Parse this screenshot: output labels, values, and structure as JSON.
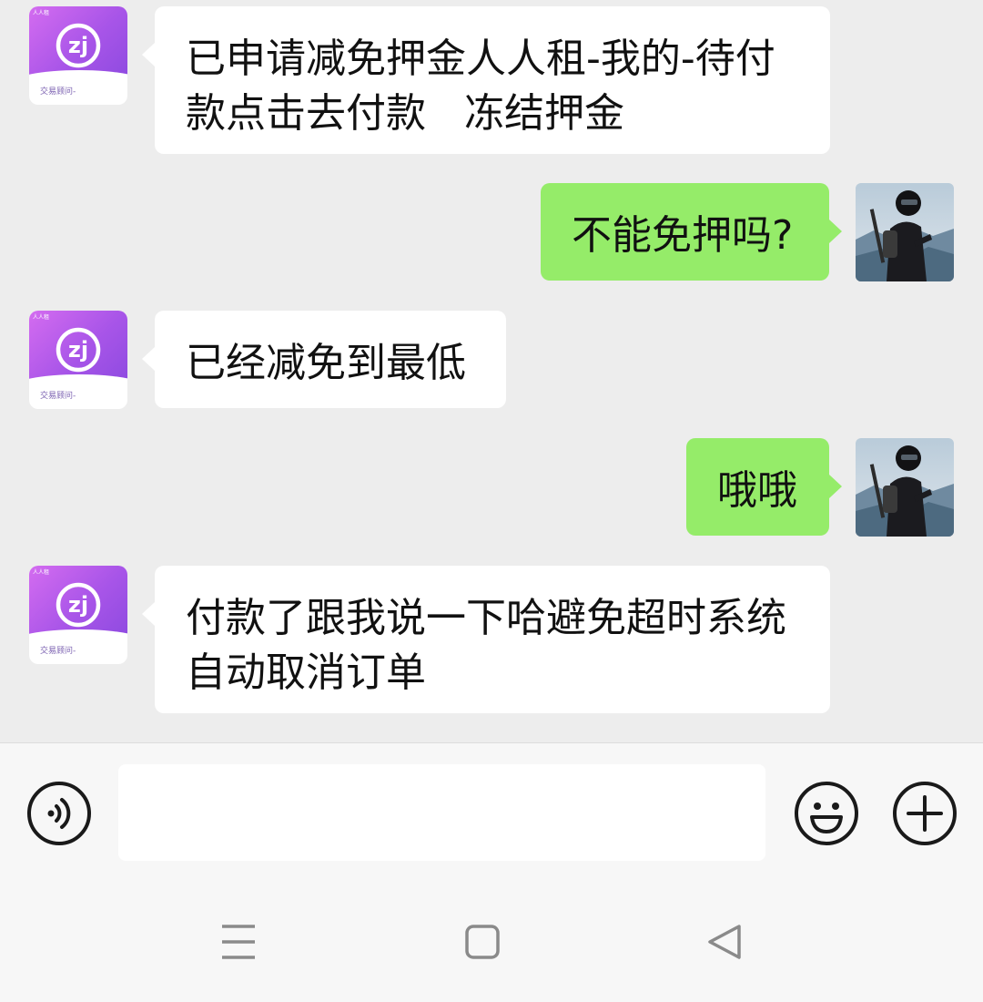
{
  "messages": [
    {
      "side": "in",
      "text_lines": [
        "已申请减免押金人人租-我的-待付",
        "款点击去付款   冻结押金"
      ]
    },
    {
      "side": "out",
      "text_lines": [
        "不能免押吗?"
      ]
    },
    {
      "side": "in",
      "text_lines": [
        "已经减免到最低"
      ]
    },
    {
      "side": "out",
      "text_lines": [
        "哦哦"
      ]
    },
    {
      "side": "in",
      "text_lines": [
        "付款了跟我说一下哈避免超时系统",
        "自动取消订单"
      ]
    }
  ],
  "contact_avatar": {
    "caption": "交易顾问-",
    "mini_label": "人人租",
    "icon": "zj-logo-icon",
    "accent": "#a855e8"
  },
  "my_avatar": {
    "icon": "hiker-photo-avatar"
  },
  "input_bar": {
    "voice_icon": "voice-icon",
    "emoji_icon": "emoji-icon",
    "more_icon": "plus-icon",
    "value": "",
    "placeholder": ""
  },
  "navbar": {
    "menu_icon": "menu-icon",
    "home_icon": "home-icon",
    "back_icon": "back-icon"
  },
  "colors": {
    "outgoing_bubble": "#95ec69",
    "incoming_bubble": "#ffffff",
    "chat_background": "#ededed"
  }
}
